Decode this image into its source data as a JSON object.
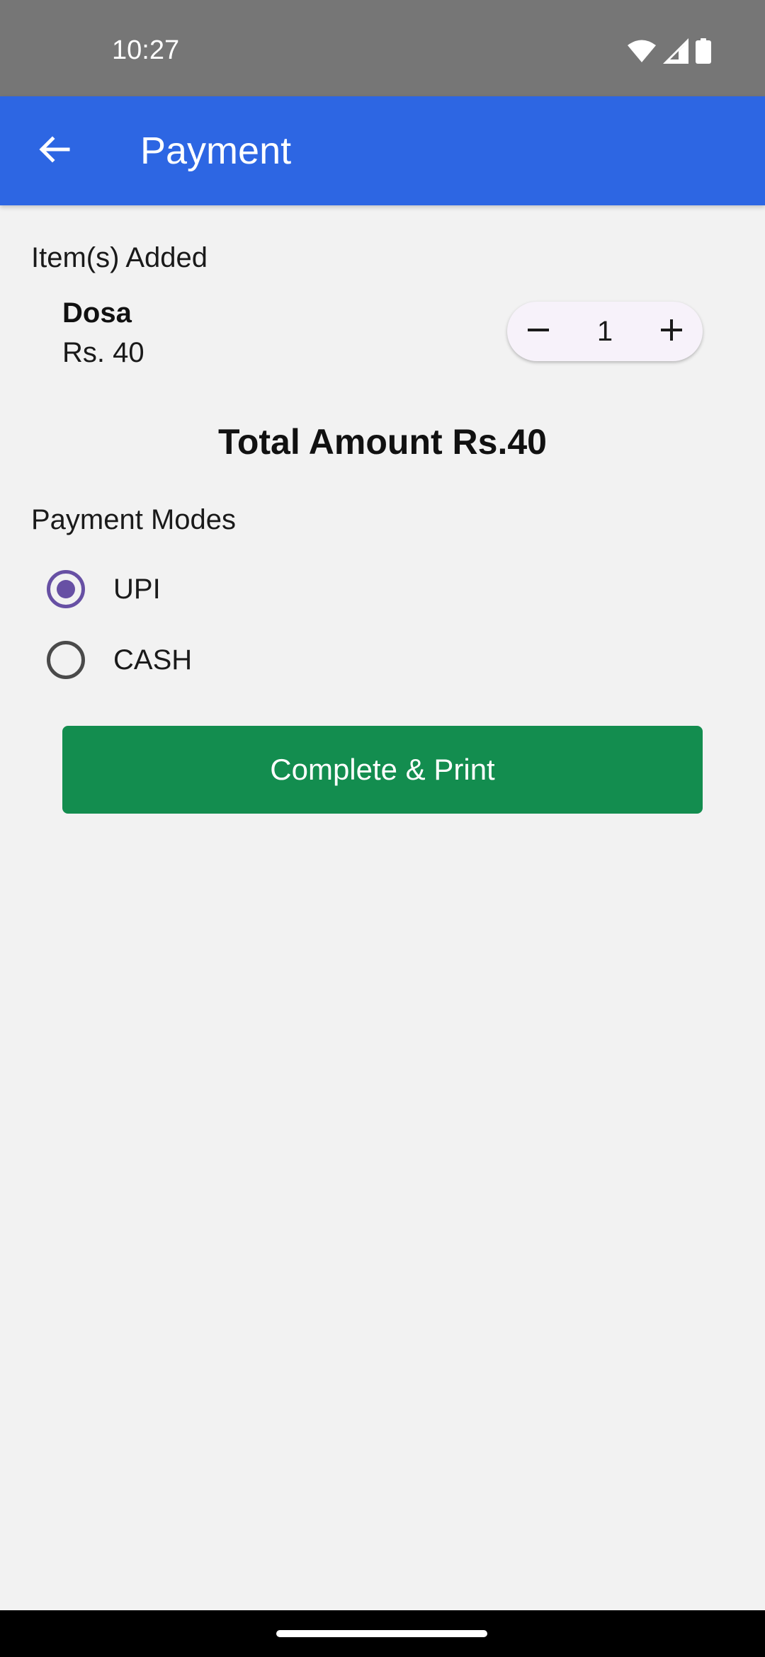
{
  "status_bar": {
    "time": "10:27",
    "icons": [
      "wifi-icon",
      "signal-icon",
      "battery-icon"
    ]
  },
  "app_bar": {
    "title": "Payment",
    "back_icon": "arrow-back-icon",
    "background_color": "#2d66e3"
  },
  "items_section": {
    "label": "Item(s) Added",
    "items": [
      {
        "name": "Dosa",
        "price": "Rs. 40",
        "quantity": "1",
        "decrement_icon": "minus-icon",
        "increment_icon": "plus-icon"
      }
    ]
  },
  "total": {
    "text": "Total Amount Rs.40"
  },
  "payment_modes": {
    "label": "Payment Modes",
    "options": [
      {
        "label": "UPI",
        "selected": true
      },
      {
        "label": "CASH",
        "selected": false
      }
    ],
    "selected_color": "#6750a4"
  },
  "actions": {
    "complete_label": "Complete & Print",
    "button_color": "#138d4f"
  }
}
